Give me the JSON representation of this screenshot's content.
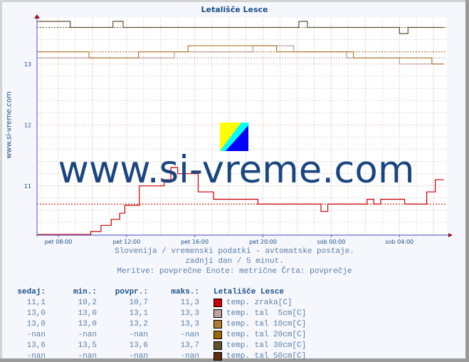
{
  "chart_data": {
    "type": "line",
    "title": "Letališče Lesce",
    "side_label": "www.si-vreme.com",
    "watermark": "www.si-vreme.com",
    "xlabel": "",
    "ylabel": "",
    "x_unit": "hours since pet 00:00",
    "xlim": [
      6.75,
      30.7
    ],
    "ylim": [
      10.19,
      13.7
    ],
    "x_ticks": [
      {
        "label": "pet 08:00",
        "x": 8
      },
      {
        "label": "pet 12:00",
        "x": 12
      },
      {
        "label": "pet 16:00",
        "x": 16
      },
      {
        "label": "pet 20:00",
        "x": 20
      },
      {
        "label": "sob 00:00",
        "x": 24
      },
      {
        "label": "sob 04:00",
        "x": 28
      }
    ],
    "y_ticks": [
      {
        "label": "11",
        "y": 11
      },
      {
        "label": "12",
        "y": 12
      },
      {
        "label": "13",
        "y": 13
      }
    ],
    "grid": true,
    "series": [
      {
        "name": "temp. zraka[C]",
        "color": "#cc0000",
        "avg": 10.7,
        "points": [
          [
            6.75,
            10.2
          ],
          [
            9.9,
            10.2
          ],
          [
            9.9,
            10.25
          ],
          [
            10.5,
            10.25
          ],
          [
            10.5,
            10.35
          ],
          [
            11.1,
            10.35
          ],
          [
            11.1,
            10.45
          ],
          [
            11.6,
            10.45
          ],
          [
            11.6,
            10.55
          ],
          [
            11.9,
            10.55
          ],
          [
            11.9,
            10.68
          ],
          [
            12.75,
            10.68
          ],
          [
            12.75,
            11.0
          ],
          [
            14.2,
            11.0
          ],
          [
            14.2,
            11.1
          ],
          [
            14.6,
            11.1
          ],
          [
            14.6,
            11.3
          ],
          [
            15.0,
            11.3
          ],
          [
            15.0,
            11.2
          ],
          [
            16.2,
            11.2
          ],
          [
            16.2,
            10.9
          ],
          [
            17.1,
            10.9
          ],
          [
            17.1,
            10.78
          ],
          [
            19.7,
            10.78
          ],
          [
            19.7,
            10.7
          ],
          [
            23.4,
            10.7
          ],
          [
            23.4,
            10.58
          ],
          [
            23.8,
            10.58
          ],
          [
            23.8,
            10.7
          ],
          [
            26.1,
            10.7
          ],
          [
            26.1,
            10.78
          ],
          [
            26.5,
            10.78
          ],
          [
            26.5,
            10.7
          ],
          [
            26.9,
            10.7
          ],
          [
            26.9,
            10.78
          ],
          [
            28.3,
            10.78
          ],
          [
            28.3,
            10.7
          ],
          [
            29.6,
            10.7
          ],
          [
            29.6,
            10.9
          ],
          [
            30.1,
            10.9
          ],
          [
            30.1,
            11.1
          ],
          [
            30.6,
            11.1
          ]
        ]
      },
      {
        "name": "temp. tal  5cm[C]",
        "color": "#c09a9a",
        "avg": 13.1,
        "points": [
          [
            6.75,
            13.1
          ],
          [
            14.8,
            13.1
          ],
          [
            14.8,
            13.2
          ],
          [
            19.4,
            13.2
          ],
          [
            19.4,
            13.3
          ],
          [
            21.8,
            13.3
          ],
          [
            21.8,
            13.2
          ],
          [
            24.9,
            13.2
          ],
          [
            24.9,
            13.1
          ],
          [
            28.0,
            13.1
          ],
          [
            28.0,
            13.0
          ],
          [
            30.6,
            13.0
          ]
        ]
      },
      {
        "name": "temp. tal 10cm[C]",
        "color": "#b07a30",
        "avg": 13.2,
        "points": [
          [
            6.75,
            13.2
          ],
          [
            9.8,
            13.2
          ],
          [
            9.8,
            13.1
          ],
          [
            12.7,
            13.1
          ],
          [
            12.7,
            13.2
          ],
          [
            15.6,
            13.2
          ],
          [
            15.6,
            13.3
          ],
          [
            20.8,
            13.3
          ],
          [
            20.8,
            13.2
          ],
          [
            25.3,
            13.2
          ],
          [
            25.3,
            13.1
          ],
          [
            29.9,
            13.1
          ],
          [
            29.9,
            13.0
          ],
          [
            30.6,
            13.0
          ]
        ]
      },
      {
        "name": "temp. tal 20cm[C]",
        "color": "#a06800",
        "avg": null,
        "points": []
      },
      {
        "name": "temp. tal 30cm[C]",
        "color": "#605030",
        "avg": 13.6,
        "points": [
          [
            6.75,
            13.7
          ],
          [
            8.7,
            13.7
          ],
          [
            8.7,
            13.6
          ],
          [
            11.2,
            13.6
          ],
          [
            11.2,
            13.7
          ],
          [
            11.8,
            13.7
          ],
          [
            11.8,
            13.6
          ],
          [
            22.1,
            13.6
          ],
          [
            22.1,
            13.7
          ],
          [
            22.6,
            13.7
          ],
          [
            22.6,
            13.6
          ],
          [
            28.0,
            13.6
          ],
          [
            28.0,
            13.5
          ],
          [
            28.5,
            13.5
          ],
          [
            28.5,
            13.6
          ],
          [
            30.6,
            13.6
          ]
        ]
      },
      {
        "name": "temp. tal 50cm[C]",
        "color": "#603010",
        "avg": null,
        "points": []
      }
    ]
  },
  "info": {
    "line1": "Slovenija / vremenski podatki - avtomatske postaje.",
    "line2": "zadnji dan / 5 minut.",
    "line3": "Meritve: povprečne  Enote: metrične  Črta: povprečje"
  },
  "table": {
    "headers": [
      "sedaj:",
      "min.:",
      "povpr.:",
      "maks.:"
    ],
    "station": "Letališče Lesce",
    "rows": [
      {
        "now": "11,1",
        "min": "10,2",
        "avg": "10,7",
        "max": "11,3",
        "label": "temp. zraka[C]",
        "color": "#cc0000"
      },
      {
        "now": "13,0",
        "min": "13,0",
        "avg": "13,1",
        "max": "13,3",
        "label": "temp. tal  5cm[C]",
        "color": "#c0a0a0"
      },
      {
        "now": "13,0",
        "min": "13,0",
        "avg": "13,2",
        "max": "13,3",
        "label": "temp. tal 10cm[C]",
        "color": "#b07a30"
      },
      {
        "now": "-nan",
        "min": "-nan",
        "avg": "-nan",
        "max": "-nan",
        "label": "temp. tal 20cm[C]",
        "color": "#a06800"
      },
      {
        "now": "13,6",
        "min": "13,5",
        "avg": "13,6",
        "max": "13,7",
        "label": "temp. tal 30cm[C]",
        "color": "#605030"
      },
      {
        "now": "-nan",
        "min": "-nan",
        "avg": "-nan",
        "max": "-nan",
        "label": "temp. tal 50cm[C]",
        "color": "#603010"
      }
    ]
  }
}
